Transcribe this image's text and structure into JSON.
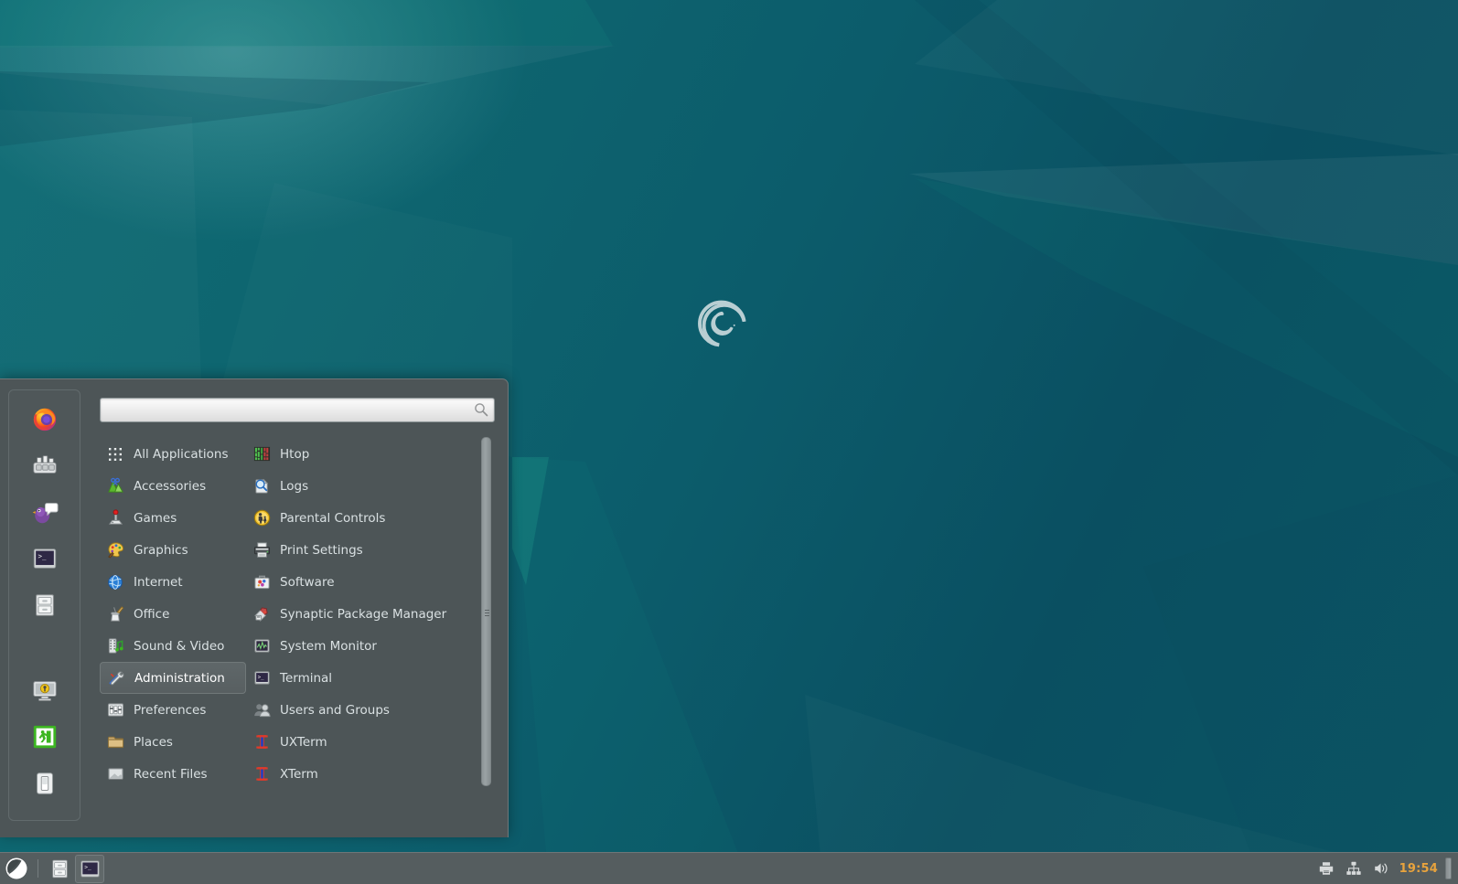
{
  "desktop": {
    "wallpaper_name": "debian-teal-polygon-wallpaper",
    "logo_name": "debian-swirl-logo",
    "colors": {
      "wallpaper_base": "#0c5c6b",
      "wallpaper_dark": "#0a4f61",
      "wallpaper_light": "#1a8a86",
      "panel_bg": "#4d5557",
      "panel_border": "#6e7779",
      "text": "#d9e0e2",
      "clock_accent": "#e8a33d",
      "selection_bg": "#5f6769"
    }
  },
  "menu": {
    "search": {
      "value": "",
      "placeholder": "",
      "icon": "search-icon"
    },
    "rail": [
      {
        "name": "firefox",
        "label": "Firefox Web Browser",
        "icon": "firefox-icon"
      },
      {
        "name": "settings-manager",
        "label": "Settings Manager",
        "icon": "settings-manager-icon"
      },
      {
        "name": "pidgin",
        "label": "Pidgin Internet Messenger",
        "icon": "pidgin-icon"
      },
      {
        "name": "terminal",
        "label": "Terminal Emulator",
        "icon": "terminal-icon"
      },
      {
        "name": "file-manager",
        "label": "File Manager",
        "icon": "file-cabinet-icon"
      },
      {
        "name": "lock-screen",
        "label": "Lock Screen",
        "icon": "lock-screen-icon"
      },
      {
        "name": "log-out",
        "label": "Log Out",
        "icon": "exit-door-icon"
      },
      {
        "name": "switch-user",
        "label": "Switch User",
        "icon": "power-switch-icon"
      }
    ],
    "categories": [
      {
        "label": "All Applications",
        "icon": "grid-dots-icon",
        "selected": false
      },
      {
        "label": "Accessories",
        "icon": "accessories-icon",
        "selected": false
      },
      {
        "label": "Games",
        "icon": "joystick-icon",
        "selected": false
      },
      {
        "label": "Graphics",
        "icon": "palette-icon",
        "selected": false
      },
      {
        "label": "Internet",
        "icon": "globe-icon",
        "selected": false
      },
      {
        "label": "Office",
        "icon": "office-icon",
        "selected": false
      },
      {
        "label": "Sound & Video",
        "icon": "film-note-icon",
        "selected": false
      },
      {
        "label": "Administration",
        "icon": "tools-icon",
        "selected": true
      },
      {
        "label": "Preferences",
        "icon": "sliders-icon",
        "selected": false
      },
      {
        "label": "Places",
        "icon": "folder-icon",
        "selected": false
      },
      {
        "label": "Recent Files",
        "icon": "recent-files-icon",
        "selected": false
      }
    ],
    "applications": [
      {
        "label": "Htop",
        "icon": "htop-icon"
      },
      {
        "label": "Logs",
        "icon": "logs-icon"
      },
      {
        "label": "Parental Controls",
        "icon": "parental-controls-icon"
      },
      {
        "label": "Print Settings",
        "icon": "printer-icon"
      },
      {
        "label": "Software",
        "icon": "software-icon"
      },
      {
        "label": "Synaptic Package Manager",
        "icon": "synaptic-icon"
      },
      {
        "label": "System Monitor",
        "icon": "system-monitor-icon"
      },
      {
        "label": "Terminal",
        "icon": "terminal-icon"
      },
      {
        "label": "Users and Groups",
        "icon": "users-groups-icon"
      },
      {
        "label": "UXTerm",
        "icon": "xterm-icon"
      },
      {
        "label": "XTerm",
        "icon": "xterm-icon"
      }
    ]
  },
  "taskbar": {
    "menu_button": {
      "label": "Applications",
      "icon": "debian-menu-icon"
    },
    "launchers": [
      {
        "label": "File Manager",
        "icon": "file-cabinet-icon"
      }
    ],
    "windows": [
      {
        "label": "Terminal",
        "icon": "terminal-icon",
        "active": true
      }
    ],
    "tray": [
      {
        "name": "printer",
        "label": "Print Queue",
        "icon": "printer-tray-icon"
      },
      {
        "name": "network",
        "label": "Network Connections",
        "icon": "network-icon"
      },
      {
        "name": "volume",
        "label": "Audio Volume",
        "icon": "volume-icon"
      }
    ],
    "clock": "19:54"
  }
}
